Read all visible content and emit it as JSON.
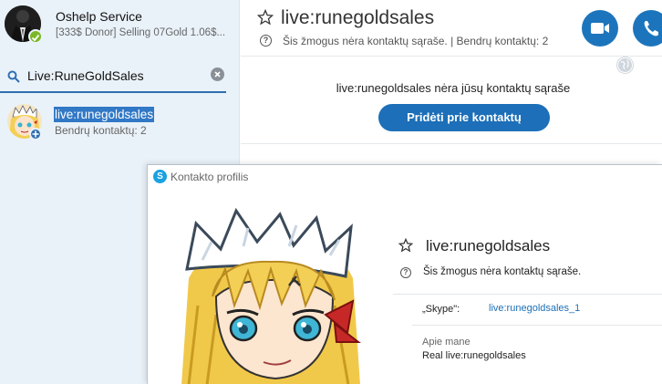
{
  "sidebar": {
    "me": {
      "name": "Oshelp Service",
      "mood": "[333$ Donor] Selling 07Gold 1.06$..."
    },
    "search": {
      "value": "Live:RuneGoldSales",
      "clear_icon": "close-circle-icon"
    },
    "result": {
      "name": "live:runegoldsales",
      "subtitle": "Bendrų kontaktų: 2"
    }
  },
  "chat": {
    "title": "live:runegoldsales",
    "subtitle": "Šis žmogus nėra kontaktų sąraše.  |  Bendrų kontaktų: 2",
    "notice": "live:runegoldsales nėra jūsų kontaktų sąraše",
    "add_button": "Pridėti prie kontaktų",
    "info_glyph": "?"
  },
  "profile_window": {
    "title": "Kontakto profilis",
    "name": "live:runegoldsales",
    "notice": "Šis žmogus nėra kontaktų sąraše.",
    "skype_label": "„Skype\":",
    "skype_value": "live:runegoldsales_1",
    "about_label": "Apie mane",
    "about_value": "Real live:runegoldsales",
    "info_glyph": "?",
    "skype_glyph": "S"
  },
  "colors": {
    "accent": "#1c6fb8",
    "sidebar_bg": "#eaf2f9",
    "online": "#7ab829",
    "selection": "#3178c6"
  }
}
